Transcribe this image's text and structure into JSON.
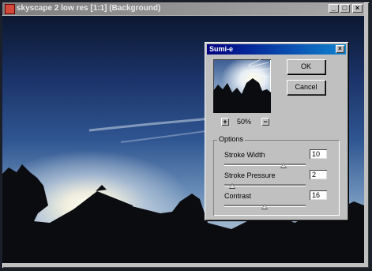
{
  "document": {
    "title": "skyscape 2 low res [1:1] (Background)",
    "window_buttons": {
      "minimize": "_",
      "maximize": "□",
      "close": "×"
    }
  },
  "dialog": {
    "title": "Sumi-e",
    "close": "×",
    "zoom": {
      "minus": "+",
      "value": "50%",
      "plus": "−"
    },
    "ok_label": "OK",
    "cancel_label": "Cancel",
    "options_label": "Options",
    "options": [
      {
        "label": "Stroke Width",
        "value": "10",
        "slider_fraction": 0.73
      },
      {
        "label": "Stroke Pressure",
        "value": "2",
        "slider_fraction": 0.1
      },
      {
        "label": "Contrast",
        "value": "16",
        "slider_fraction": 0.5
      }
    ]
  },
  "icons": [
    "app-icon",
    "minimize-icon",
    "maximize-icon",
    "close-icon",
    "zoom-in-icon",
    "zoom-out-icon",
    "slider-thumb-icon"
  ]
}
